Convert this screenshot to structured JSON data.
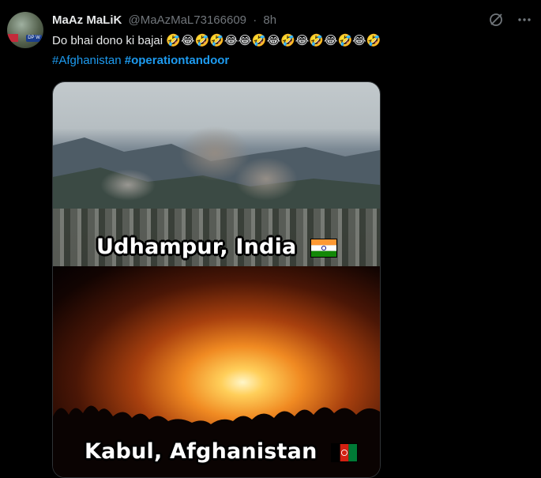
{
  "tweet": {
    "display_name": "MaAz MaLiK",
    "handle": "@MaAzMaL73166609",
    "separator": "·",
    "time": "8h",
    "text": "Do bhai dono ki bajai",
    "emojis": "🤣😂🤣🤣😂😂🤣😂🤣😂🤣😂🤣😂🤣",
    "hashtags": [
      "#Afghanistan",
      "#operationtandoor"
    ],
    "avatar_badge": "DP W"
  },
  "actions": {
    "grok_icon": "slash-circle-icon",
    "more_icon": "more-dots-icon"
  },
  "media": {
    "caption_top": "Udhampur, India",
    "caption_bottom": "Kabul, Afghanistan"
  },
  "colors": {
    "background": "#000000",
    "text": "#e7e9ea",
    "muted": "#71767b",
    "link": "#1d9bf0"
  }
}
